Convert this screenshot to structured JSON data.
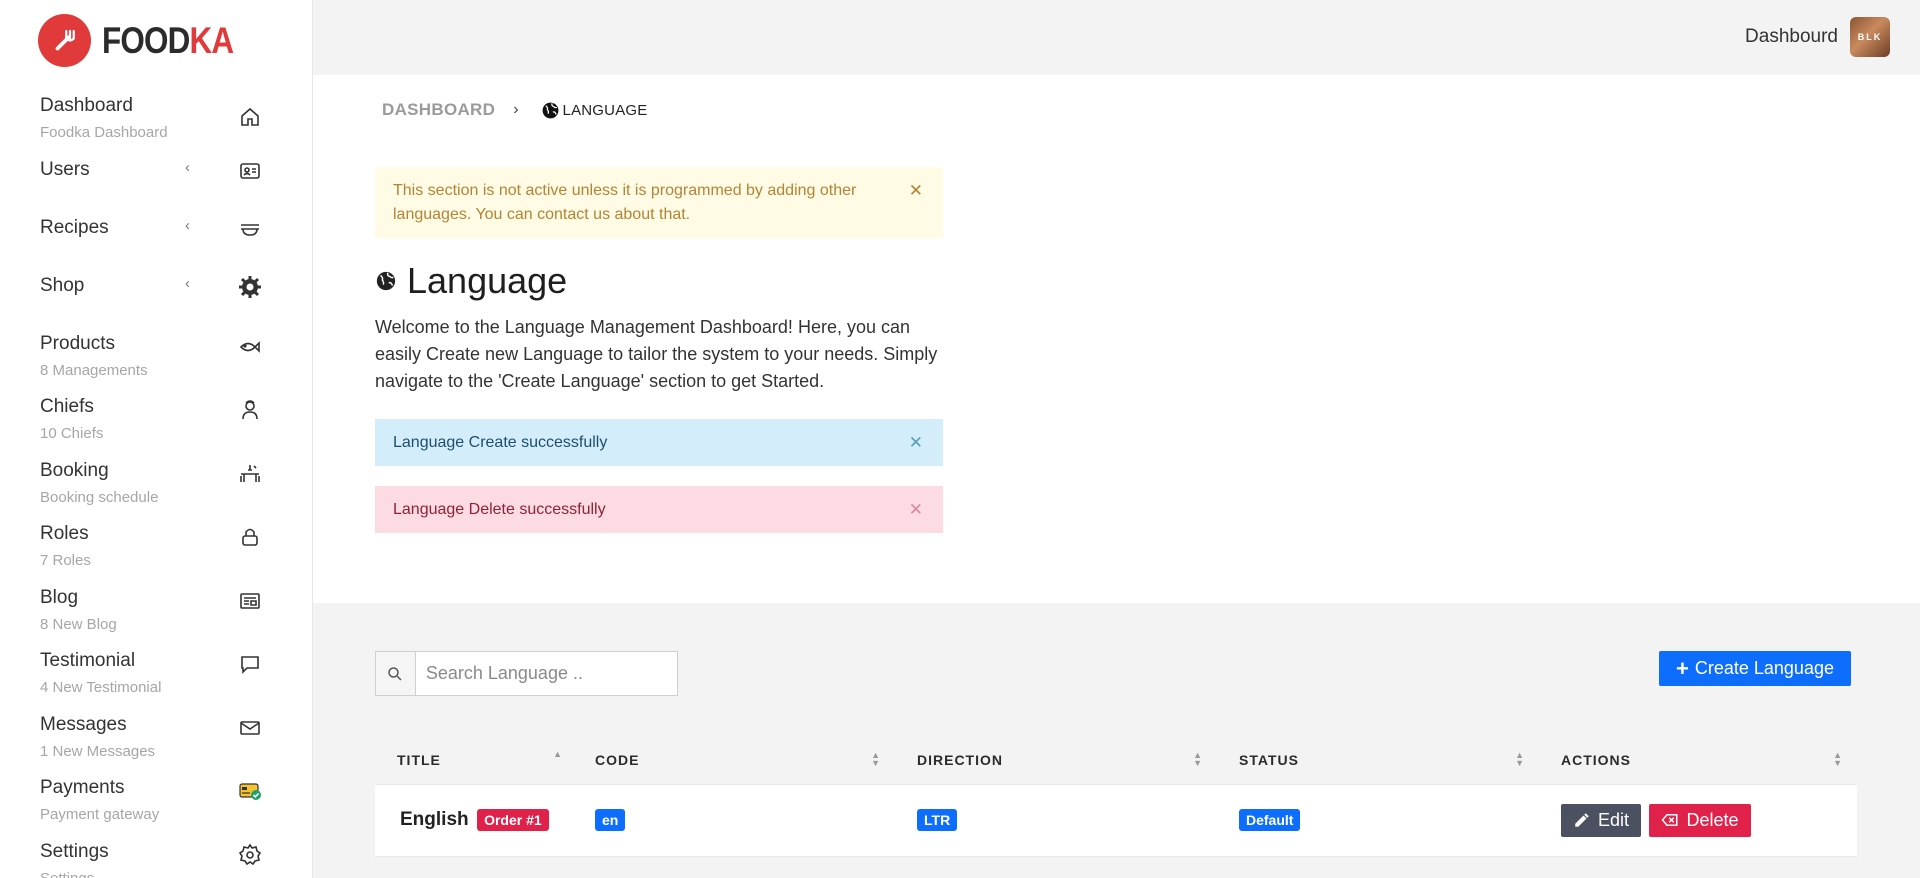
{
  "brand": {
    "name_part1": "FOOD",
    "name_part2": "KA"
  },
  "topbar": {
    "user_label": "Dashbourd",
    "avatar_text": "BLK"
  },
  "sidebar": {
    "items": [
      {
        "label": "Dashboard",
        "sub": "Foodka Dashboard",
        "icon": "home-icon"
      },
      {
        "label": "Users",
        "chevron": "‹",
        "icon": "id-card-icon"
      },
      {
        "label": "Recipes",
        "chevron": "‹",
        "icon": "recipe-tray-icon"
      },
      {
        "label": "Shop",
        "chevron": "‹",
        "icon": "gear-badge-icon"
      },
      {
        "label": "Products",
        "sub": "8 Managements",
        "icon": "fish-icon"
      },
      {
        "label": "Chiefs",
        "sub": "10 Chiefs",
        "icon": "chef-icon"
      },
      {
        "label": "Booking",
        "sub": "Booking schedule",
        "icon": "dining-table-icon"
      },
      {
        "label": "Roles",
        "sub": "7 Roles",
        "icon": "lock-icon"
      },
      {
        "label": "Blog",
        "sub": "8 New Blog",
        "icon": "newspaper-icon"
      },
      {
        "label": "Testimonial",
        "sub": "4 New Testimonial",
        "icon": "chat-icon"
      },
      {
        "label": "Messages",
        "sub": "1 New Messages",
        "icon": "mail-icon"
      },
      {
        "label": "Payments",
        "sub": "Payment gateway",
        "icon": "payment-card-icon"
      },
      {
        "label": "Settings",
        "sub": "Settings",
        "icon": "settings-icon"
      }
    ]
  },
  "breadcrumb": {
    "home": "DASHBOARD",
    "separator": "›",
    "current": "LANGUAGE"
  },
  "alerts": {
    "warning": "This section is not active unless it is programmed by adding other languages. You can contact us about that.",
    "info": "Language Create successfully",
    "danger": "Language Delete successfully",
    "close": "✕"
  },
  "page": {
    "title": "Language",
    "intro": "Welcome to the Language Management Dashboard! Here, you can easily Create new Language to tailor the system to your needs. Simply navigate to the 'Create Language' section to get Started."
  },
  "search": {
    "placeholder": "Search Language .."
  },
  "create_button": {
    "plus": "+",
    "label": "Create Language"
  },
  "table": {
    "columns": [
      "TITLE",
      "CODE",
      "DIRECTION",
      "STATUS",
      "ACTIONS"
    ],
    "rows": [
      {
        "title": "English",
        "order_badge": "Order #1",
        "code": "en",
        "direction": "LTR",
        "status": "Default",
        "edit_label": "Edit",
        "delete_label": "Delete"
      }
    ]
  },
  "colors": {
    "brand_red": "#e03a3a",
    "primary_blue": "#0d6efd",
    "danger": "#e0224a",
    "edit_gray": "#4b5160"
  }
}
